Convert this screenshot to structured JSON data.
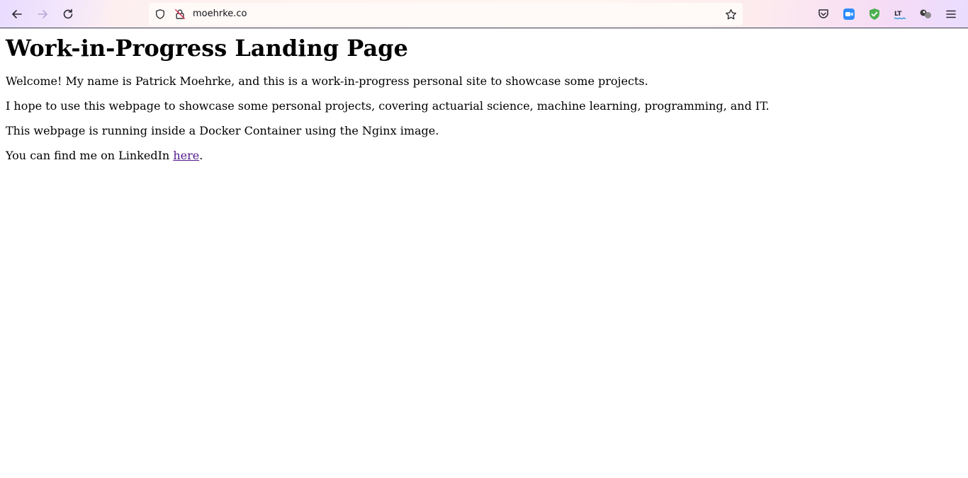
{
  "browser": {
    "url": "moehrke.co",
    "icons": [
      "back-arrow-icon",
      "forward-arrow-icon",
      "reload-icon",
      "shield-icon",
      "insecure-lock-icon",
      "bookmark-star-icon",
      "pocket-icon",
      "zoom-icon",
      "shield-check-icon",
      "languagetool-icon",
      "extension-icon",
      "menu-icon"
    ],
    "colors": {
      "zoom": "#2d8cff",
      "shield_check": "#4caf50",
      "link_visited": "#551a8b"
    }
  },
  "page": {
    "heading": "Work-in-Progress Landing Page",
    "paragraphs": [
      "Welcome! My name is Patrick Moehrke, and this is a work-in-progress personal site to showcase some projects.",
      "I hope to use this webpage to showcase some personal projects, covering actuarial science, machine learning, programming, and IT.",
      "This webpage is running inside a Docker Container using the Nginx image."
    ],
    "linkedin_prefix": "You can find me on LinkedIn ",
    "linkedin_link": "here",
    "linkedin_suffix": "."
  }
}
